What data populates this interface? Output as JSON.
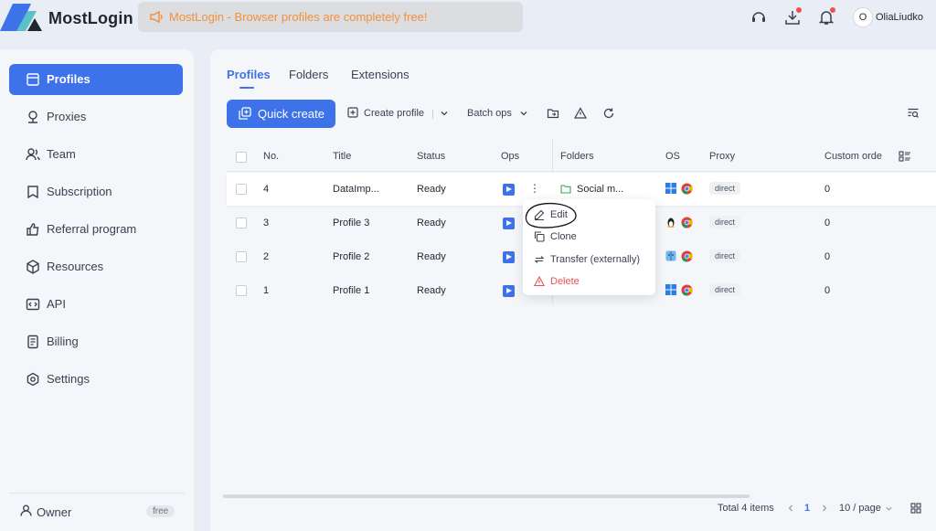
{
  "app": {
    "title": "MostLogin",
    "notice": "MostLogin - Browser profiles are completely free!"
  },
  "user": {
    "initial": "O",
    "name": "OliaLiudko"
  },
  "sidebar": {
    "items": [
      {
        "label": "Profiles",
        "icon": "profiles-icon"
      },
      {
        "label": "Proxies",
        "icon": "proxies-icon"
      },
      {
        "label": "Team",
        "icon": "team-icon"
      },
      {
        "label": "Subscription",
        "icon": "subscription-icon"
      },
      {
        "label": "Referral program",
        "icon": "referral-icon"
      },
      {
        "label": "Resources",
        "icon": "resources-icon"
      },
      {
        "label": "API",
        "icon": "api-icon"
      },
      {
        "label": "Billing",
        "icon": "billing-icon"
      },
      {
        "label": "Settings",
        "icon": "settings-icon"
      }
    ],
    "footer": {
      "role": "Owner",
      "plan": "free"
    }
  },
  "tabs": [
    "Profiles",
    "Folders",
    "Extensions"
  ],
  "toolbar": {
    "quick_create": "Quick create",
    "create_profile": "Create profile",
    "batch_ops": "Batch ops"
  },
  "table": {
    "headers": {
      "no": "No.",
      "title": "Title",
      "status": "Status",
      "ops": "Ops",
      "folders": "Folders",
      "os": "OS",
      "proxy": "Proxy",
      "order": "Custom orde"
    },
    "rows": [
      {
        "no": "4",
        "title": "DataImp...",
        "status": "Ready",
        "folder": "Social m...",
        "os": "windows",
        "proxy": "direct",
        "order": "0"
      },
      {
        "no": "3",
        "title": "Profile 3",
        "status": "Ready",
        "folder": "",
        "os": "linux",
        "proxy": "direct",
        "order": "0"
      },
      {
        "no": "2",
        "title": "Profile 2",
        "status": "Ready",
        "folder": "",
        "os": "macos",
        "proxy": "direct",
        "order": "0"
      },
      {
        "no": "1",
        "title": "Profile 1",
        "status": "Ready",
        "folder": "",
        "os": "windows",
        "proxy": "direct",
        "order": "0"
      }
    ]
  },
  "menu": {
    "edit": "Edit",
    "clone": "Clone",
    "transfer": "Transfer (externally)",
    "delete": "Delete"
  },
  "pagination": {
    "total": "Total 4 items",
    "page": "1",
    "per_page": "10 / page"
  },
  "colors": {
    "accent": "#3d72e8",
    "notice_text": "#f0913d",
    "danger": "#e55353"
  }
}
